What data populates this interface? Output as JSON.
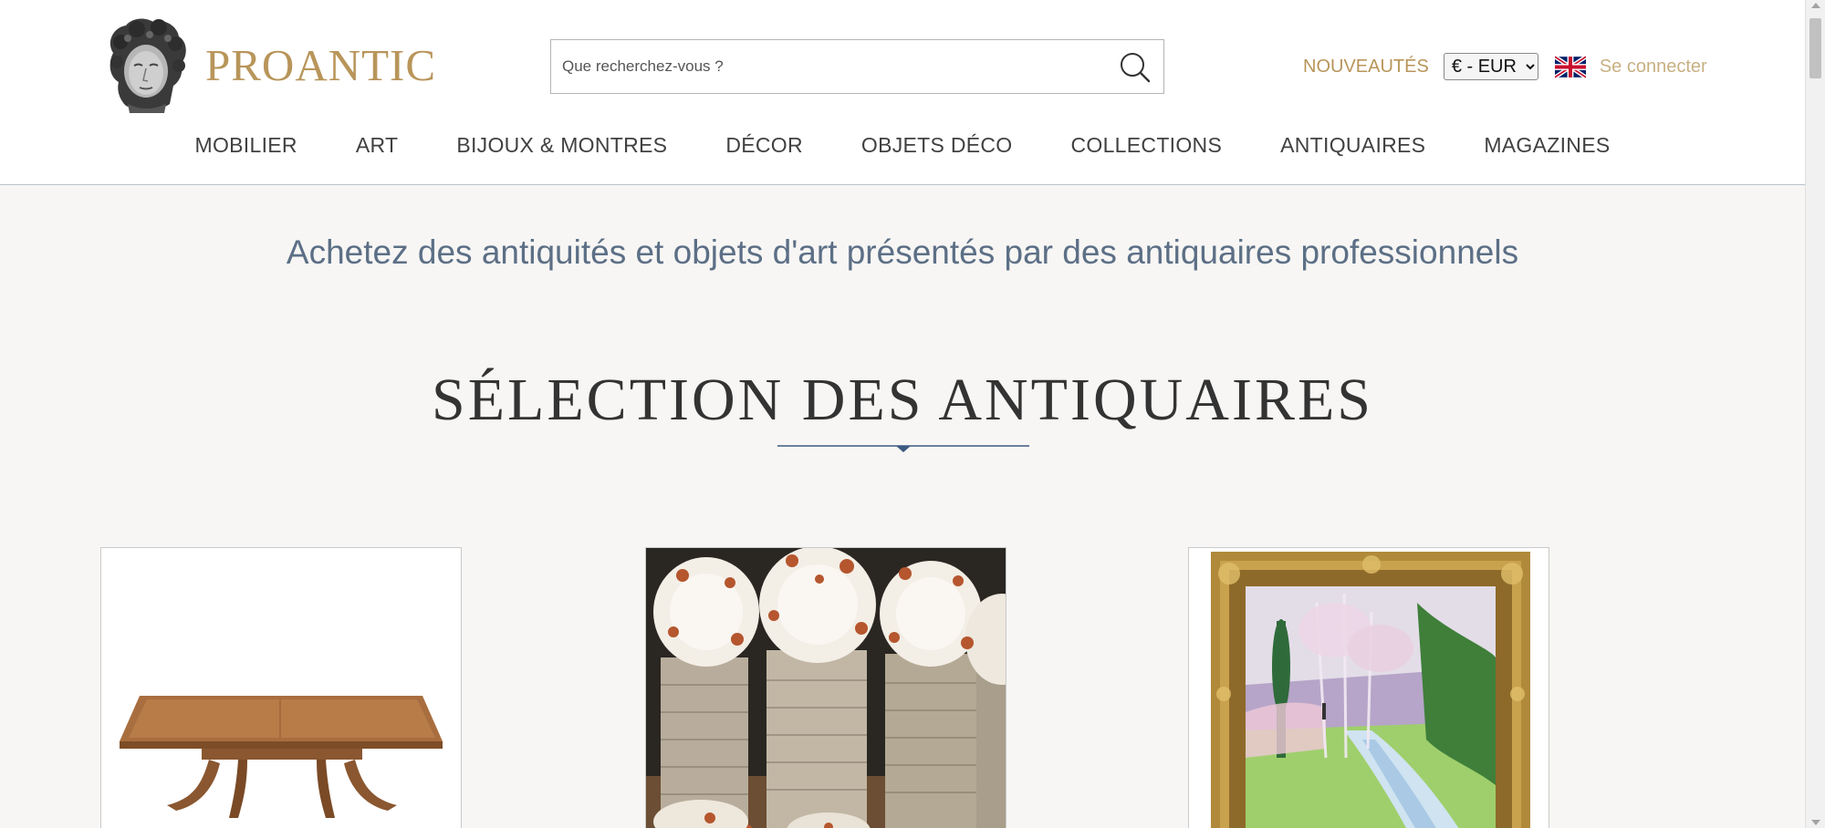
{
  "logo": {
    "text": "PROANTIC",
    "icon": "sculpted-head-logo"
  },
  "search": {
    "placeholder": "Que recherchez-vous ?",
    "value": "",
    "icon": "search-icon"
  },
  "top_links": {
    "new_label": "NOUVEAUTÉS",
    "currency_selected": "€ - EUR",
    "language_icon": "uk-flag-icon",
    "login_label": "Se connecter"
  },
  "nav": {
    "items": [
      {
        "label": "MOBILIER"
      },
      {
        "label": "ART"
      },
      {
        "label": "BIJOUX & MONTRES"
      },
      {
        "label": "DÉCOR"
      },
      {
        "label": "OBJETS DÉCO"
      },
      {
        "label": "COLLECTIONS"
      },
      {
        "label": "ANTIQUAIRES"
      },
      {
        "label": "MAGAZINES"
      }
    ]
  },
  "tagline": "Achetez des antiquités et objets d'art présentés par des antiquaires professionnels",
  "section": {
    "title": "SÉLECTION DES ANTIQUAIRES"
  },
  "products": [
    {
      "image": "wooden-dining-table"
    },
    {
      "image": "porcelain-plate-set"
    },
    {
      "image": "framed-landscape-painting"
    }
  ],
  "colors": {
    "brand_gold": "#b8955a",
    "login_gold": "#c8b083",
    "tagline_blue": "#5c6f86",
    "divider_blue": "#3d5a80",
    "background": "#f7f6f4"
  }
}
